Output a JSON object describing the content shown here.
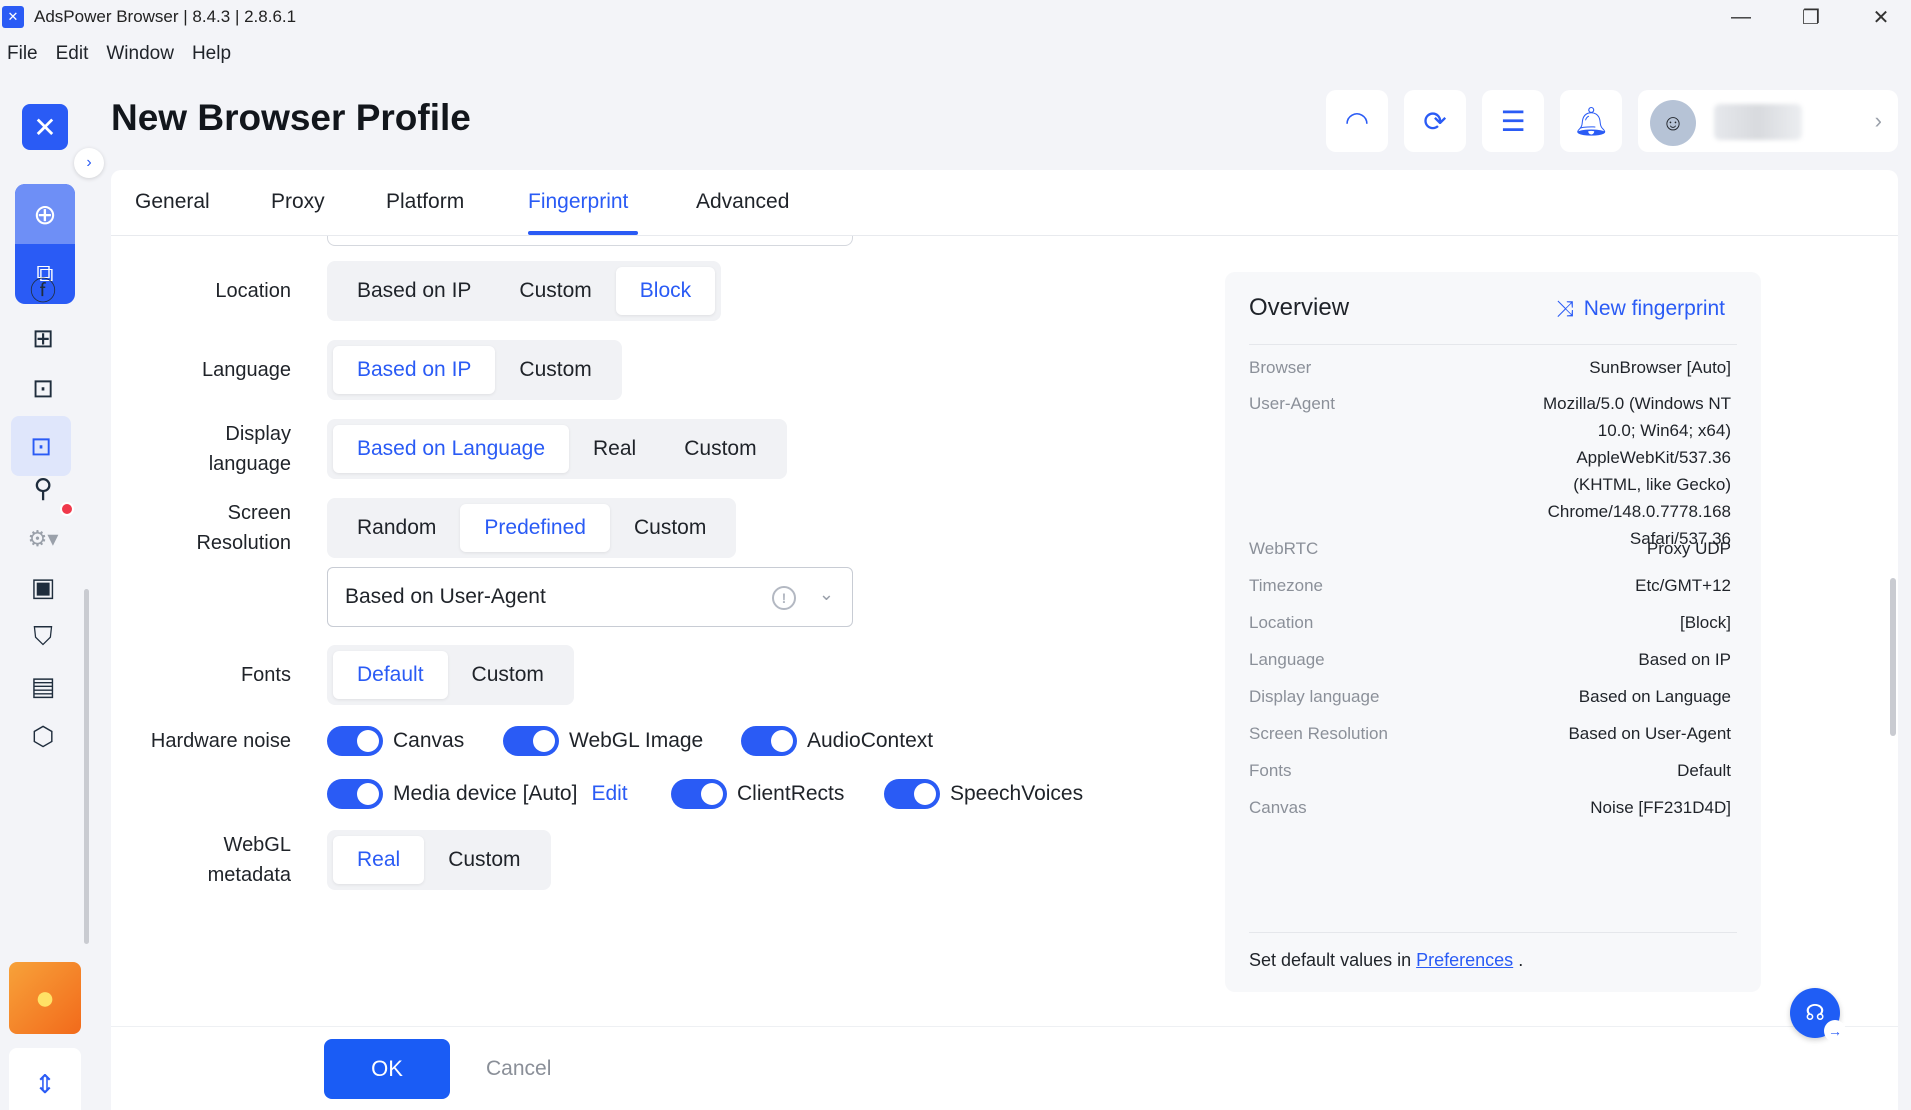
{
  "window": {
    "title": "AdsPower Browser | 8.4.3 | 2.8.6.1",
    "min": "—",
    "restore": "❐",
    "close": "✕"
  },
  "menu": [
    "File",
    "Edit",
    "Window",
    "Help"
  ],
  "header": {
    "title": "New Browser Profile"
  },
  "tabs": [
    {
      "label": "General"
    },
    {
      "label": "Proxy"
    },
    {
      "label": "Platform"
    },
    {
      "label": "Fingerprint",
      "active": true
    },
    {
      "label": "Advanced"
    }
  ],
  "form": {
    "location": {
      "label": "Location",
      "options": [
        "Based on IP",
        "Custom",
        "Block"
      ],
      "selected": "Block"
    },
    "language": {
      "label": "Language",
      "options": [
        "Based on IP",
        "Custom"
      ],
      "selected": "Based on IP"
    },
    "display_language": {
      "label_line1": "Display",
      "label_line2": "language",
      "options": [
        "Based on Language",
        "Real",
        "Custom"
      ],
      "selected": "Based on Language"
    },
    "screen_resolution": {
      "label_line1": "Screen",
      "label_line2": "Resolution",
      "options": [
        "Random",
        "Predefined",
        "Custom"
      ],
      "selected": "Predefined",
      "dropdown_value": "Based on User-Agent"
    },
    "fonts": {
      "label": "Fonts",
      "options": [
        "Default",
        "Custom"
      ],
      "selected": "Default"
    },
    "hardware_noise": {
      "label": "Hardware noise",
      "items": [
        {
          "label": "Canvas",
          "on": true
        },
        {
          "label": "WebGL Image",
          "on": true
        },
        {
          "label": "AudioContext",
          "on": true
        },
        {
          "label": "Media device [Auto]",
          "on": true,
          "edit": "Edit"
        },
        {
          "label": "ClientRects",
          "on": true
        },
        {
          "label": "SpeechVoices",
          "on": true
        }
      ]
    },
    "webgl_metadata": {
      "label_line1": "WebGL",
      "label_line2": "metadata",
      "options": [
        "Real",
        "Custom"
      ],
      "selected": "Real"
    }
  },
  "footer": {
    "ok": "OK",
    "cancel": "Cancel"
  },
  "overview": {
    "title": "Overview",
    "new_fingerprint": "New fingerprint",
    "rows": [
      {
        "key": "Browser",
        "value": [
          "SunBrowser [Auto]"
        ]
      },
      {
        "key": "User-Agent",
        "value": [
          "Mozilla/5.0 (Windows NT",
          "10.0; Win64; x64)",
          "AppleWebKit/537.36",
          "(KHTML, like Gecko)",
          "Chrome/148.0.7778.168",
          "Safari/537.36"
        ]
      },
      {
        "key": "WebRTC",
        "value": [
          "Proxy UDP"
        ]
      },
      {
        "key": "Timezone",
        "value": [
          "Etc/GMT+12"
        ]
      },
      {
        "key": "Location",
        "value": [
          "[Block]"
        ]
      },
      {
        "key": "Language",
        "value": [
          "Based on IP"
        ]
      },
      {
        "key": "Display language",
        "value": [
          "Based on Language"
        ]
      },
      {
        "key": "Screen Resolution",
        "value": [
          "Based on User-Agent"
        ]
      },
      {
        "key": "Fonts",
        "value": [
          "Default"
        ]
      },
      {
        "key": "Canvas",
        "value": [
          "Noise [FF231D4D]"
        ]
      }
    ],
    "footer_text": "Set default values in",
    "footer_link": "Preferences",
    "footer_end": "."
  },
  "colors": {
    "accent": "#2a5bf5",
    "alert_dot": "#f0384b",
    "coin": "#f26a1b"
  }
}
